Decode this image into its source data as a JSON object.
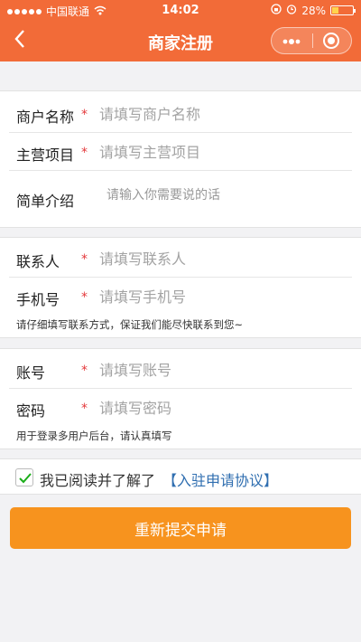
{
  "status_bar": {
    "carrier": "中国联通",
    "time": "14:02",
    "battery": "28%",
    "battery_level": 0.28,
    "accent": "#f26b38"
  },
  "navbar": {
    "back_icon": "chevron-left-icon",
    "title": "商家注册",
    "more_icon": "more-dots-icon",
    "close_icon": "target-circle-icon"
  },
  "form": {
    "section1": [
      {
        "label": "商户名称",
        "required": "*",
        "placeholder": "请填写商户名称",
        "value": ""
      },
      {
        "label": "主营项目",
        "required": "*",
        "placeholder": "请填写主营项目",
        "value": ""
      },
      {
        "label": "简单介绍",
        "placeholder": "请输入你需要说的话",
        "value": ""
      }
    ],
    "section2": [
      {
        "label": "联系人",
        "required": "*",
        "placeholder": "请填写联系人",
        "value": ""
      },
      {
        "label": "手机号",
        "required": "*",
        "placeholder": "请填写手机号",
        "value": ""
      }
    ],
    "section2_hint": "请仔细填写联系方式，保证我们能尽快联系到您~",
    "section3": [
      {
        "label": "账号",
        "required": "*",
        "placeholder": "请填写账号",
        "value": ""
      },
      {
        "label": "密码",
        "required": "*",
        "placeholder": "请填写密码",
        "value": ""
      }
    ],
    "section3_hint": "用于登录多用户后台，请认真填写"
  },
  "agreement": {
    "checked": true,
    "text": "我已阅读并了解了",
    "link": "【入驻申请协议】",
    "link_color": "#2f6eb0"
  },
  "submit": {
    "label": "重新提交申请",
    "color": "#f7931e"
  }
}
